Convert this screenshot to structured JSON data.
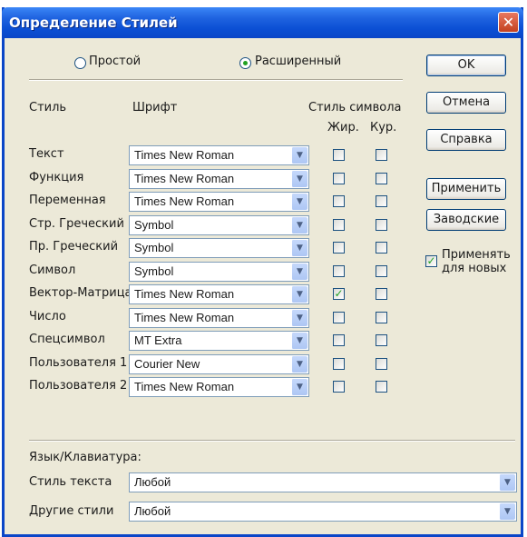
{
  "window": {
    "title": "Определение Стилей"
  },
  "mode": {
    "simple_label": "Простой",
    "extended_label": "Расширенный",
    "selected": "extended"
  },
  "headers": {
    "style": "Стиль",
    "font": "Шрифт",
    "char_style": "Стиль символа",
    "bold": "Жир.",
    "italic": "Кур."
  },
  "rows": [
    {
      "name": "Текст",
      "font": "Times New Roman",
      "bold": false,
      "italic": false
    },
    {
      "name": "Функция",
      "font": "Times New Roman",
      "bold": false,
      "italic": false
    },
    {
      "name": "Переменная",
      "font": "Times New Roman",
      "bold": false,
      "italic": false
    },
    {
      "name": "Стр. Греческий",
      "font": "Symbol",
      "bold": false,
      "italic": false
    },
    {
      "name": "Пр. Греческий",
      "font": "Symbol",
      "bold": false,
      "italic": false
    },
    {
      "name": "Символ",
      "font": "Symbol",
      "bold": false,
      "italic": false
    },
    {
      "name": "Вектор-Матрица",
      "font": "Times New Roman",
      "bold": true,
      "italic": false
    },
    {
      "name": "Число",
      "font": "Times New Roman",
      "bold": false,
      "italic": false
    },
    {
      "name": "Спецсимвол",
      "font": "MT Extra",
      "bold": false,
      "italic": false
    },
    {
      "name": "Пользователя 1",
      "font": "Courier New",
      "bold": false,
      "italic": false
    },
    {
      "name": "Пользователя 2",
      "font": "Times New Roman",
      "bold": false,
      "italic": false
    }
  ],
  "buttons": {
    "ok": "OK",
    "cancel": "Отмена",
    "help": "Справка",
    "apply": "Применить",
    "factory": "Заводские"
  },
  "apply_new": {
    "label_line1": "Применять",
    "label_line2": "для новых",
    "checked": true
  },
  "language": {
    "header": "Язык/Клавиатура:",
    "text_style_label": "Стиль текста",
    "text_style_value": "Любой",
    "other_styles_label": "Другие стили",
    "other_styles_value": "Любой"
  }
}
